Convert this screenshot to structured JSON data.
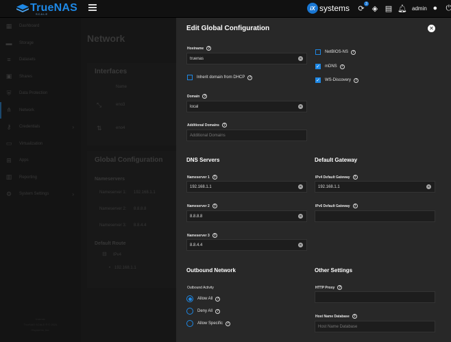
{
  "topbar": {
    "brand_name": "TrueNAS",
    "brand_sub": "SCALE",
    "vendor": "systems",
    "vendor_badge": "iX",
    "user": "admin",
    "notification_count": "3"
  },
  "sidebar": {
    "items": [
      {
        "label": "Dashboard",
        "icon": "dashboard-icon"
      },
      {
        "label": "Storage",
        "icon": "storage-icon"
      },
      {
        "label": "Datasets",
        "icon": "datasets-icon"
      },
      {
        "label": "Shares",
        "icon": "shares-icon"
      },
      {
        "label": "Data Protection",
        "icon": "shield-icon"
      },
      {
        "label": "Network",
        "icon": "network-icon"
      },
      {
        "label": "Credentials",
        "icon": "key-icon"
      },
      {
        "label": "Virtualization",
        "icon": "laptop-icon"
      },
      {
        "label": "Apps",
        "icon": "apps-icon"
      },
      {
        "label": "Reporting",
        "icon": "chart-icon"
      },
      {
        "label": "System Settings",
        "icon": "gear-icon"
      }
    ],
    "footer_line1": "truenas",
    "footer_line2": "TrueNAS SCALE ® © 2024",
    "footer_line3": "iXsystems, Inc."
  },
  "main": {
    "title": "Network",
    "interfaces_title": "Interfaces",
    "interfaces_col_name": "Name",
    "interfaces": [
      "eno3",
      "eno4"
    ],
    "global_title": "Global Configuration",
    "nameservers_title": "Nameservers",
    "nameservers": [
      {
        "label": "Nameserver 1:",
        "value": "192.168.1.1"
      },
      {
        "label": "Nameserver 2:",
        "value": "8.8.8.8"
      },
      {
        "label": "Nameserver 3:",
        "value": "8.8.4.4"
      }
    ],
    "default_route_title": "Default Route",
    "route_type": "IPv4",
    "route_value": "192.168.1.1"
  },
  "panel": {
    "title": "Edit Global Configuration",
    "hostname_label": "Hostname",
    "hostname_value": "truenas",
    "inherit_label": "Inherit domain from DHCP",
    "inherit_checked": false,
    "domain_label": "Domain",
    "domain_value": "local",
    "additional_domains_label": "Additional Domains",
    "additional_domains_placeholder": "Additional Domains",
    "netbios_label": "NetBIOS-NS",
    "netbios_checked": false,
    "mdns_label": "mDNS",
    "mdns_checked": true,
    "wsd_label": "WS-Discovery",
    "wsd_checked": true,
    "dns_section": "DNS Servers",
    "ns1_label": "Nameserver 1",
    "ns1_value": "192.168.1.1",
    "ns2_label": "Nameserver 2",
    "ns2_value": "8.8.8.8",
    "ns3_label": "Nameserver 3",
    "ns3_value": "8.8.4.4",
    "gateway_section": "Default Gateway",
    "ipv4_gw_label": "IPv4 Default Gateway",
    "ipv4_gw_value": "192.168.1.1",
    "ipv6_gw_label": "IPv6 Default Gateway",
    "ipv6_gw_value": "",
    "outbound_section": "Outbound Network",
    "outbound_activity_label": "Outbound Activity",
    "outbound_options": [
      "Allow All",
      "Deny All",
      "Allow Specific"
    ],
    "outbound_selected": "Allow All",
    "other_section": "Other Settings",
    "http_proxy_label": "HTTP Proxy",
    "http_proxy_value": "",
    "host_db_label": "Host Name Database",
    "host_db_placeholder": "Host Name Database"
  },
  "colors": {
    "accent": "#1e88e5",
    "panel_bg": "#282828",
    "input_bg": "#1d1d1d"
  }
}
